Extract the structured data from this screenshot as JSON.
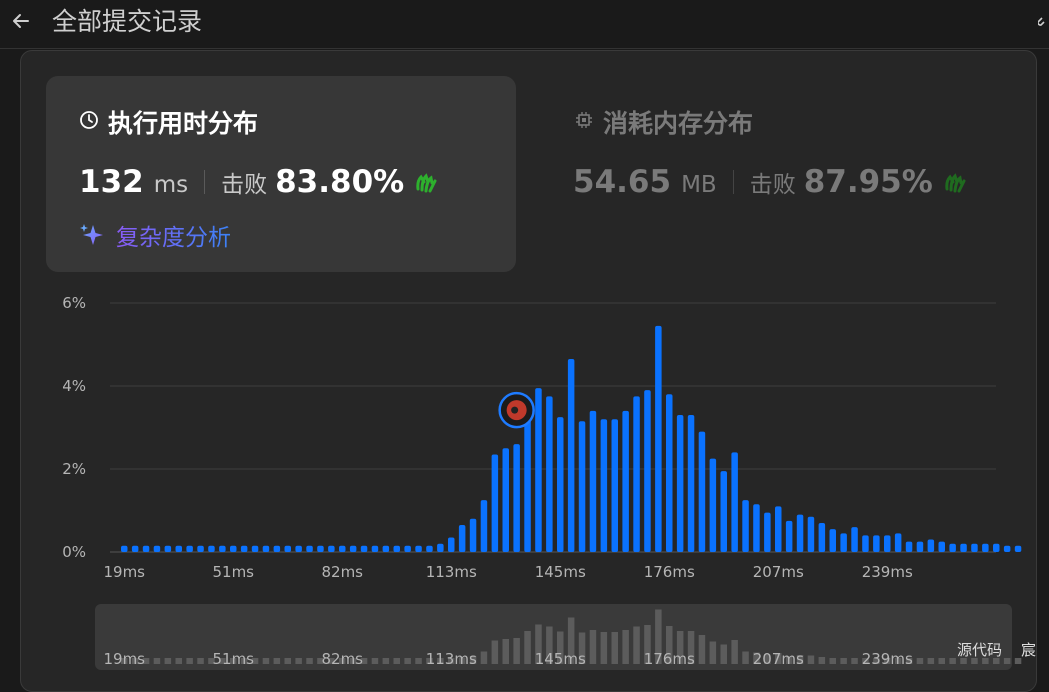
{
  "header": {
    "title": "全部提交记录"
  },
  "runtime": {
    "title": "执行用时分布",
    "value": "132",
    "unit": "ms",
    "beat_label": "击败",
    "beat_pct": "83.80%",
    "analysis_label": "复杂度分析"
  },
  "memory": {
    "title": "消耗内存分布",
    "value": "54.65",
    "unit": "MB",
    "beat_label": "击败",
    "beat_pct": "87.95%"
  },
  "footer": {
    "source_label": "源代码",
    "user_char": "宸"
  },
  "colors": {
    "bar": "#0a72ff",
    "mini_bar": "#5c5c5c",
    "highlight": "#2db02d"
  },
  "chart_data": {
    "type": "bar",
    "ylim": [
      0,
      6
    ],
    "y_ticks": [
      "0%",
      "2%",
      "4%",
      "6%"
    ],
    "x_tick_labels": [
      "19ms",
      "51ms",
      "82ms",
      "113ms",
      "145ms",
      "176ms",
      "207ms",
      "239ms"
    ],
    "highlight_bin": "132ms",
    "values": [
      0.15,
      0.15,
      0.15,
      0.15,
      0.15,
      0.15,
      0.15,
      0.15,
      0.15,
      0.15,
      0.15,
      0.15,
      0.15,
      0.15,
      0.15,
      0.15,
      0.15,
      0.15,
      0.15,
      0.15,
      0.15,
      0.15,
      0.15,
      0.15,
      0.15,
      0.15,
      0.15,
      0.15,
      0.15,
      0.2,
      0.35,
      0.65,
      0.8,
      1.25,
      2.35,
      2.5,
      2.6,
      3.3,
      3.95,
      3.75,
      3.25,
      4.65,
      3.15,
      3.4,
      3.2,
      3.2,
      3.4,
      3.75,
      3.9,
      5.45,
      3.8,
      3.3,
      3.3,
      2.9,
      2.25,
      1.95,
      2.4,
      1.25,
      1.15,
      0.95,
      1.1,
      0.75,
      0.9,
      0.85,
      0.7,
      0.55,
      0.45,
      0.6,
      0.4,
      0.4,
      0.4,
      0.45,
      0.25,
      0.25,
      0.3,
      0.25,
      0.2,
      0.2,
      0.2,
      0.2,
      0.2,
      0.15,
      0.15
    ]
  }
}
